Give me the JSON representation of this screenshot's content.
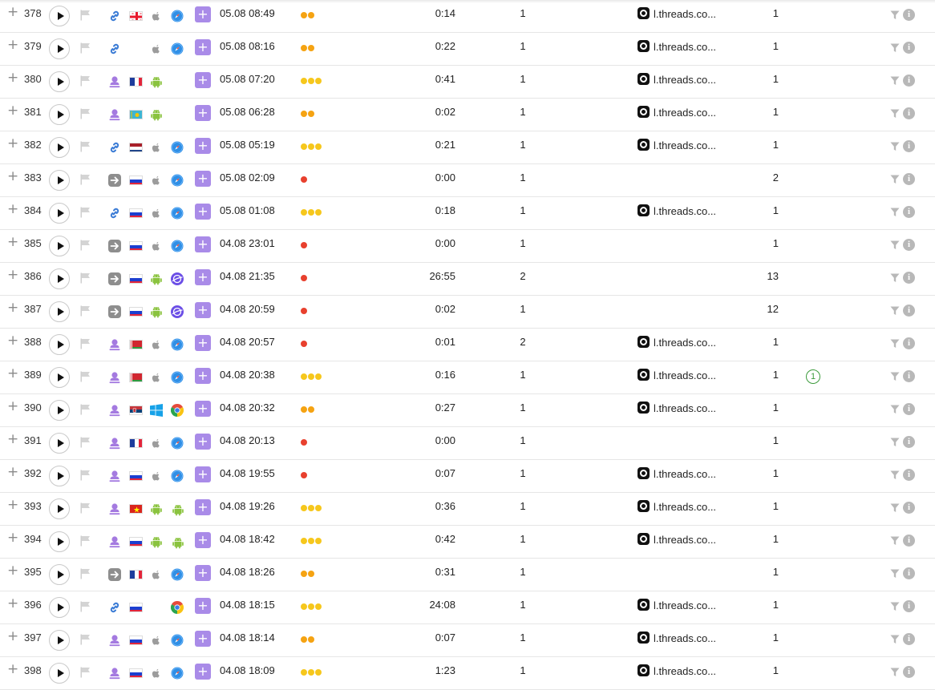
{
  "colors": {
    "dot_red": "#e8402e",
    "dot_orange": "#f5a312",
    "dot_yellow": "#f6c71c",
    "add_button": "#a98be8",
    "badge_green": "#3c9b3c"
  },
  "icons": {
    "plus": "+",
    "add": "+",
    "info": "i"
  },
  "rows": [
    {
      "num": "378",
      "source": "link-icon",
      "country": "georgia-flag",
      "os": "apple-icon",
      "browser": "safari-icon",
      "datetime": "05.08 08:49",
      "engagement": "orange",
      "dots": 2,
      "duration": "0:14",
      "pages": "1",
      "referrer": "l.threads.co...",
      "count": "1",
      "badge": ""
    },
    {
      "num": "379",
      "source": "link-icon",
      "country": "",
      "os": "apple-icon",
      "browser": "safari-icon",
      "datetime": "05.08 08:16",
      "engagement": "orange",
      "dots": 2,
      "duration": "0:22",
      "pages": "1",
      "referrer": "l.threads.co...",
      "count": "1",
      "badge": ""
    },
    {
      "num": "380",
      "source": "user-pin-icon",
      "country": "france-flag",
      "os": "android-icon",
      "browser": "",
      "datetime": "05.08 07:20",
      "engagement": "yellow",
      "dots": 3,
      "duration": "0:41",
      "pages": "1",
      "referrer": "l.threads.co...",
      "count": "1",
      "badge": ""
    },
    {
      "num": "381",
      "source": "user-pin-icon",
      "country": "kazakhstan-flag",
      "os": "android-icon",
      "browser": "",
      "datetime": "05.08 06:28",
      "engagement": "orange",
      "dots": 2,
      "duration": "0:02",
      "pages": "1",
      "referrer": "l.threads.co...",
      "count": "1",
      "badge": ""
    },
    {
      "num": "382",
      "source": "link-icon",
      "country": "netherlands-flag",
      "os": "apple-icon",
      "browser": "safari-icon",
      "datetime": "05.08 05:19",
      "engagement": "yellow",
      "dots": 3,
      "duration": "0:21",
      "pages": "1",
      "referrer": "l.threads.co...",
      "count": "1",
      "badge": ""
    },
    {
      "num": "383",
      "source": "direct-arrow-icon",
      "country": "russia-flag",
      "os": "apple-icon",
      "browser": "safari-icon",
      "datetime": "05.08 02:09",
      "engagement": "red",
      "dots": 1,
      "duration": "0:00",
      "pages": "1",
      "referrer": "",
      "count": "2",
      "badge": ""
    },
    {
      "num": "384",
      "source": "link-icon",
      "country": "russia-flag",
      "os": "apple-icon",
      "browser": "safari-icon",
      "datetime": "05.08 01:08",
      "engagement": "yellow",
      "dots": 3,
      "duration": "0:18",
      "pages": "1",
      "referrer": "l.threads.co...",
      "count": "1",
      "badge": ""
    },
    {
      "num": "385",
      "source": "direct-arrow-icon",
      "country": "russia-flag",
      "os": "apple-icon",
      "browser": "safari-icon",
      "datetime": "04.08 23:01",
      "engagement": "red",
      "dots": 1,
      "duration": "0:00",
      "pages": "1",
      "referrer": "",
      "count": "1",
      "badge": ""
    },
    {
      "num": "386",
      "source": "direct-arrow-icon",
      "country": "russia-flag",
      "os": "android-icon",
      "browser": "samsung-internet-icon",
      "datetime": "04.08 21:35",
      "engagement": "red",
      "dots": 1,
      "duration": "26:55",
      "pages": "2",
      "referrer": "",
      "count": "13",
      "badge": ""
    },
    {
      "num": "387",
      "source": "direct-arrow-icon",
      "country": "russia-flag",
      "os": "android-icon",
      "browser": "samsung-internet-icon",
      "datetime": "04.08 20:59",
      "engagement": "red",
      "dots": 1,
      "duration": "0:02",
      "pages": "1",
      "referrer": "",
      "count": "12",
      "badge": ""
    },
    {
      "num": "388",
      "source": "user-pin-icon",
      "country": "belarus-flag",
      "os": "apple-icon",
      "browser": "safari-icon",
      "datetime": "04.08 20:57",
      "engagement": "red",
      "dots": 1,
      "duration": "0:01",
      "pages": "2",
      "referrer": "l.threads.co...",
      "count": "1",
      "badge": ""
    },
    {
      "num": "389",
      "source": "user-pin-icon",
      "country": "belarus-flag",
      "os": "apple-icon",
      "browser": "safari-icon",
      "datetime": "04.08 20:38",
      "engagement": "yellow",
      "dots": 3,
      "duration": "0:16",
      "pages": "1",
      "referrer": "l.threads.co...",
      "count": "1",
      "badge": "1"
    },
    {
      "num": "390",
      "source": "user-pin-icon",
      "country": "serbia-flag",
      "os": "windows-icon",
      "browser": "chrome-icon",
      "datetime": "04.08 20:32",
      "engagement": "orange",
      "dots": 2,
      "duration": "0:27",
      "pages": "1",
      "referrer": "l.threads.co...",
      "count": "1",
      "badge": ""
    },
    {
      "num": "391",
      "source": "user-pin-icon",
      "country": "france-flag",
      "os": "apple-icon",
      "browser": "safari-icon",
      "datetime": "04.08 20:13",
      "engagement": "red",
      "dots": 1,
      "duration": "0:00",
      "pages": "1",
      "referrer": "",
      "count": "1",
      "badge": ""
    },
    {
      "num": "392",
      "source": "user-pin-icon",
      "country": "russia-flag",
      "os": "apple-icon",
      "browser": "safari-icon",
      "datetime": "04.08 19:55",
      "engagement": "red",
      "dots": 1,
      "duration": "0:07",
      "pages": "1",
      "referrer": "l.threads.co...",
      "count": "1",
      "badge": ""
    },
    {
      "num": "393",
      "source": "user-pin-icon",
      "country": "vietnam-flag",
      "os": "android-icon",
      "browser": "android-icon",
      "datetime": "04.08 19:26",
      "engagement": "yellow",
      "dots": 3,
      "duration": "0:36",
      "pages": "1",
      "referrer": "l.threads.co...",
      "count": "1",
      "badge": ""
    },
    {
      "num": "394",
      "source": "user-pin-icon",
      "country": "russia-flag",
      "os": "android-icon",
      "browser": "android-icon",
      "datetime": "04.08 18:42",
      "engagement": "yellow",
      "dots": 3,
      "duration": "0:42",
      "pages": "1",
      "referrer": "l.threads.co...",
      "count": "1",
      "badge": ""
    },
    {
      "num": "395",
      "source": "direct-arrow-icon",
      "country": "france-flag",
      "os": "apple-icon",
      "browser": "safari-icon",
      "datetime": "04.08 18:26",
      "engagement": "orange",
      "dots": 2,
      "duration": "0:31",
      "pages": "1",
      "referrer": "",
      "count": "1",
      "badge": ""
    },
    {
      "num": "396",
      "source": "link-icon",
      "country": "russia-flag",
      "os": "",
      "browser": "chrome-icon",
      "datetime": "04.08 18:15",
      "engagement": "yellow",
      "dots": 3,
      "duration": "24:08",
      "pages": "1",
      "referrer": "l.threads.co...",
      "count": "1",
      "badge": ""
    },
    {
      "num": "397",
      "source": "user-pin-icon",
      "country": "russia-flag",
      "os": "apple-icon",
      "browser": "safari-icon",
      "datetime": "04.08 18:14",
      "engagement": "orange",
      "dots": 2,
      "duration": "0:07",
      "pages": "1",
      "referrer": "l.threads.co...",
      "count": "1",
      "badge": ""
    },
    {
      "num": "398",
      "source": "user-pin-icon",
      "country": "russia-flag",
      "os": "apple-icon",
      "browser": "safari-icon",
      "datetime": "04.08 18:09",
      "engagement": "yellow",
      "dots": 3,
      "duration": "1:23",
      "pages": "1",
      "referrer": "l.threads.co...",
      "count": "1",
      "badge": ""
    }
  ]
}
